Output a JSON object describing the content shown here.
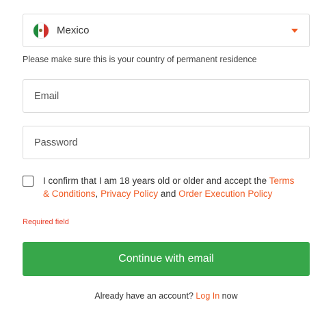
{
  "country": {
    "selected": "Mexico",
    "flag_icon": "mexico-flag-icon",
    "dropdown_icon": "caret-down-icon",
    "accent_color": "#f05a22"
  },
  "country_hint": "Please make sure this is your country of permanent residence",
  "email": {
    "placeholder": "Email",
    "value": ""
  },
  "password": {
    "placeholder": "Password",
    "value": ""
  },
  "consent": {
    "checked": false,
    "text_before": "I confirm that I am 18 years old or older and accept the ",
    "terms_link": "Terms & Conditions",
    "separator": ", ",
    "privacy_link": "Privacy Policy",
    "and_text": " and ",
    "order_link": "Order Execution Policy"
  },
  "error": {
    "required": "Required field",
    "color": "#e8412c"
  },
  "continue_button": {
    "label": "Continue with email",
    "color": "#37a74a"
  },
  "login": {
    "prefix": "Already have an account? ",
    "link": "Log In",
    "suffix": " now"
  }
}
